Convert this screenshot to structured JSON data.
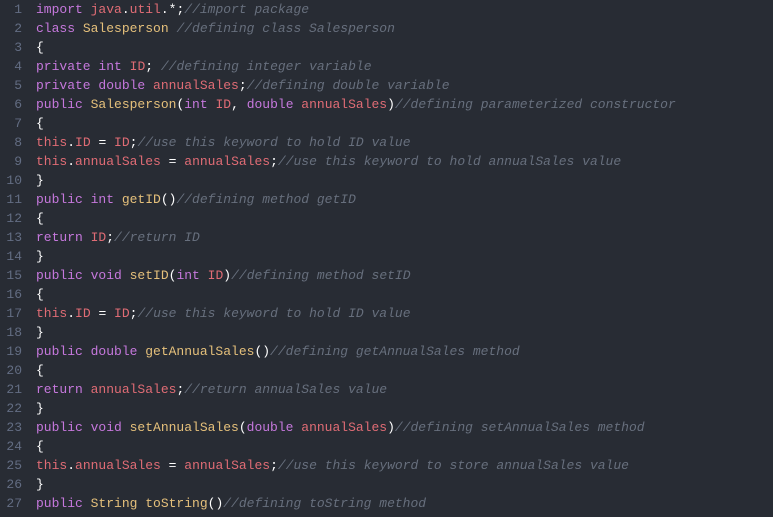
{
  "lines": [
    {
      "num": "1",
      "tokens": [
        {
          "t": "import ",
          "c": "kw"
        },
        {
          "t": "java",
          "c": "ident"
        },
        {
          "t": ".",
          "c": "punc"
        },
        {
          "t": "util",
          "c": "ident"
        },
        {
          "t": ".*;",
          "c": "punc"
        },
        {
          "t": "//import package",
          "c": "cmt"
        }
      ]
    },
    {
      "num": "2",
      "tokens": [
        {
          "t": "class ",
          "c": "kw"
        },
        {
          "t": "Salesperson ",
          "c": "cls"
        },
        {
          "t": "//defining class Salesperson",
          "c": "cmt"
        }
      ]
    },
    {
      "num": "3",
      "tokens": [
        {
          "t": "{",
          "c": "punc"
        }
      ]
    },
    {
      "num": "4",
      "tokens": [
        {
          "t": "private ",
          "c": "kw"
        },
        {
          "t": "int ",
          "c": "type"
        },
        {
          "t": "ID",
          "c": "ident"
        },
        {
          "t": "; ",
          "c": "punc"
        },
        {
          "t": "//defining integer variable",
          "c": "cmt"
        }
      ]
    },
    {
      "num": "5",
      "tokens": [
        {
          "t": "private ",
          "c": "kw"
        },
        {
          "t": "double ",
          "c": "type"
        },
        {
          "t": "annualSales",
          "c": "ident"
        },
        {
          "t": ";",
          "c": "punc"
        },
        {
          "t": "//defining double variable",
          "c": "cmt"
        }
      ]
    },
    {
      "num": "6",
      "tokens": [
        {
          "t": "public ",
          "c": "kw"
        },
        {
          "t": "Salesperson",
          "c": "fn"
        },
        {
          "t": "(",
          "c": "punc"
        },
        {
          "t": "int ",
          "c": "type"
        },
        {
          "t": "ID",
          "c": "ident"
        },
        {
          "t": ", ",
          "c": "punc"
        },
        {
          "t": "double ",
          "c": "type"
        },
        {
          "t": "annualSales",
          "c": "ident"
        },
        {
          "t": ")",
          "c": "punc"
        },
        {
          "t": "//defining parameterized constructor",
          "c": "cmt"
        }
      ]
    },
    {
      "num": "7",
      "tokens": [
        {
          "t": "{",
          "c": "punc"
        }
      ]
    },
    {
      "num": "8",
      "tokens": [
        {
          "t": "this",
          "c": "this"
        },
        {
          "t": ".",
          "c": "punc"
        },
        {
          "t": "ID ",
          "c": "prop"
        },
        {
          "t": "= ",
          "c": "op"
        },
        {
          "t": "ID",
          "c": "ident"
        },
        {
          "t": ";",
          "c": "punc"
        },
        {
          "t": "//use this keyword to hold ID value",
          "c": "cmt"
        }
      ]
    },
    {
      "num": "9",
      "tokens": [
        {
          "t": "this",
          "c": "this"
        },
        {
          "t": ".",
          "c": "punc"
        },
        {
          "t": "annualSales ",
          "c": "prop"
        },
        {
          "t": "= ",
          "c": "op"
        },
        {
          "t": "annualSales",
          "c": "ident"
        },
        {
          "t": ";",
          "c": "punc"
        },
        {
          "t": "//use this keyword to hold annualSales value",
          "c": "cmt"
        }
      ]
    },
    {
      "num": "10",
      "tokens": [
        {
          "t": "}",
          "c": "punc"
        }
      ]
    },
    {
      "num": "11",
      "tokens": [
        {
          "t": "public ",
          "c": "kw"
        },
        {
          "t": "int ",
          "c": "type"
        },
        {
          "t": "getID",
          "c": "fn"
        },
        {
          "t": "()",
          "c": "punc"
        },
        {
          "t": "//defining method getID",
          "c": "cmt"
        }
      ]
    },
    {
      "num": "12",
      "tokens": [
        {
          "t": "{",
          "c": "punc"
        }
      ]
    },
    {
      "num": "13",
      "tokens": [
        {
          "t": "return ",
          "c": "kw"
        },
        {
          "t": "ID",
          "c": "ident"
        },
        {
          "t": ";",
          "c": "punc"
        },
        {
          "t": "//return ID",
          "c": "cmt"
        }
      ]
    },
    {
      "num": "14",
      "tokens": [
        {
          "t": "}",
          "c": "punc"
        }
      ]
    },
    {
      "num": "15",
      "tokens": [
        {
          "t": "public ",
          "c": "kw"
        },
        {
          "t": "void ",
          "c": "type"
        },
        {
          "t": "setID",
          "c": "fn"
        },
        {
          "t": "(",
          "c": "punc"
        },
        {
          "t": "int ",
          "c": "type"
        },
        {
          "t": "ID",
          "c": "ident"
        },
        {
          "t": ")",
          "c": "punc"
        },
        {
          "t": "//defining method setID",
          "c": "cmt"
        }
      ]
    },
    {
      "num": "16",
      "tokens": [
        {
          "t": "{",
          "c": "punc"
        }
      ]
    },
    {
      "num": "17",
      "tokens": [
        {
          "t": "this",
          "c": "this"
        },
        {
          "t": ".",
          "c": "punc"
        },
        {
          "t": "ID ",
          "c": "prop"
        },
        {
          "t": "= ",
          "c": "op"
        },
        {
          "t": "ID",
          "c": "ident"
        },
        {
          "t": ";",
          "c": "punc"
        },
        {
          "t": "//use this keyword to hold ID value",
          "c": "cmt"
        }
      ]
    },
    {
      "num": "18",
      "tokens": [
        {
          "t": "}",
          "c": "punc"
        }
      ]
    },
    {
      "num": "19",
      "tokens": [
        {
          "t": "public ",
          "c": "kw"
        },
        {
          "t": "double ",
          "c": "type"
        },
        {
          "t": "getAnnualSales",
          "c": "fn"
        },
        {
          "t": "()",
          "c": "punc"
        },
        {
          "t": "//defining getAnnualSales method",
          "c": "cmt"
        }
      ]
    },
    {
      "num": "20",
      "tokens": [
        {
          "t": "{",
          "c": "punc"
        }
      ]
    },
    {
      "num": "21",
      "tokens": [
        {
          "t": "return ",
          "c": "kw"
        },
        {
          "t": "annualSales",
          "c": "ident"
        },
        {
          "t": ";",
          "c": "punc"
        },
        {
          "t": "//return annualSales value",
          "c": "cmt"
        }
      ]
    },
    {
      "num": "22",
      "tokens": [
        {
          "t": "}",
          "c": "punc"
        }
      ]
    },
    {
      "num": "23",
      "tokens": [
        {
          "t": "public ",
          "c": "kw"
        },
        {
          "t": "void ",
          "c": "type"
        },
        {
          "t": "setAnnualSales",
          "c": "fn"
        },
        {
          "t": "(",
          "c": "punc"
        },
        {
          "t": "double ",
          "c": "type"
        },
        {
          "t": "annualSales",
          "c": "ident"
        },
        {
          "t": ")",
          "c": "punc"
        },
        {
          "t": "//defining setAnnualSales method",
          "c": "cmt"
        }
      ]
    },
    {
      "num": "24",
      "tokens": [
        {
          "t": "{",
          "c": "punc"
        }
      ]
    },
    {
      "num": "25",
      "tokens": [
        {
          "t": "this",
          "c": "this"
        },
        {
          "t": ".",
          "c": "punc"
        },
        {
          "t": "annualSales ",
          "c": "prop"
        },
        {
          "t": "= ",
          "c": "op"
        },
        {
          "t": "annualSales",
          "c": "ident"
        },
        {
          "t": ";",
          "c": "punc"
        },
        {
          "t": "//use this keyword to store annualSales value",
          "c": "cmt"
        }
      ]
    },
    {
      "num": "26",
      "tokens": [
        {
          "t": "}",
          "c": "punc"
        }
      ]
    },
    {
      "num": "27",
      "tokens": [
        {
          "t": "public ",
          "c": "kw"
        },
        {
          "t": "String ",
          "c": "str"
        },
        {
          "t": "toString",
          "c": "fn"
        },
        {
          "t": "()",
          "c": "punc"
        },
        {
          "t": "//defining toString method",
          "c": "cmt"
        }
      ]
    }
  ]
}
